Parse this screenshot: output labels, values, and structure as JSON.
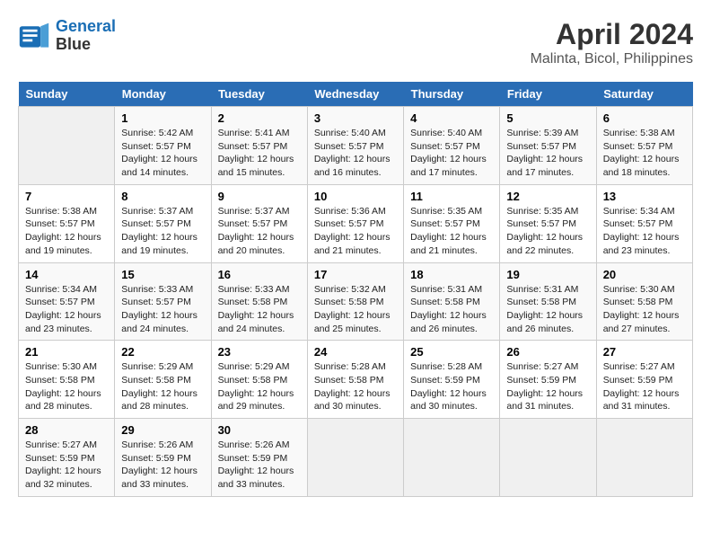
{
  "header": {
    "logo_line1": "General",
    "logo_line2": "Blue",
    "title": "April 2024",
    "subtitle": "Malinta, Bicol, Philippines"
  },
  "weekdays": [
    "Sunday",
    "Monday",
    "Tuesday",
    "Wednesday",
    "Thursday",
    "Friday",
    "Saturday"
  ],
  "weeks": [
    [
      {
        "day": "",
        "empty": true
      },
      {
        "day": "1",
        "sunrise": "5:42 AM",
        "sunset": "5:57 PM",
        "daylight": "12 hours and 14 minutes."
      },
      {
        "day": "2",
        "sunrise": "5:41 AM",
        "sunset": "5:57 PM",
        "daylight": "12 hours and 15 minutes."
      },
      {
        "day": "3",
        "sunrise": "5:40 AM",
        "sunset": "5:57 PM",
        "daylight": "12 hours and 16 minutes."
      },
      {
        "day": "4",
        "sunrise": "5:40 AM",
        "sunset": "5:57 PM",
        "daylight": "12 hours and 17 minutes."
      },
      {
        "day": "5",
        "sunrise": "5:39 AM",
        "sunset": "5:57 PM",
        "daylight": "12 hours and 17 minutes."
      },
      {
        "day": "6",
        "sunrise": "5:38 AM",
        "sunset": "5:57 PM",
        "daylight": "12 hours and 18 minutes."
      }
    ],
    [
      {
        "day": "7",
        "sunrise": "5:38 AM",
        "sunset": "5:57 PM",
        "daylight": "12 hours and 19 minutes."
      },
      {
        "day": "8",
        "sunrise": "5:37 AM",
        "sunset": "5:57 PM",
        "daylight": "12 hours and 19 minutes."
      },
      {
        "day": "9",
        "sunrise": "5:37 AM",
        "sunset": "5:57 PM",
        "daylight": "12 hours and 20 minutes."
      },
      {
        "day": "10",
        "sunrise": "5:36 AM",
        "sunset": "5:57 PM",
        "daylight": "12 hours and 21 minutes."
      },
      {
        "day": "11",
        "sunrise": "5:35 AM",
        "sunset": "5:57 PM",
        "daylight": "12 hours and 21 minutes."
      },
      {
        "day": "12",
        "sunrise": "5:35 AM",
        "sunset": "5:57 PM",
        "daylight": "12 hours and 22 minutes."
      },
      {
        "day": "13",
        "sunrise": "5:34 AM",
        "sunset": "5:57 PM",
        "daylight": "12 hours and 23 minutes."
      }
    ],
    [
      {
        "day": "14",
        "sunrise": "5:34 AM",
        "sunset": "5:57 PM",
        "daylight": "12 hours and 23 minutes."
      },
      {
        "day": "15",
        "sunrise": "5:33 AM",
        "sunset": "5:57 PM",
        "daylight": "12 hours and 24 minutes."
      },
      {
        "day": "16",
        "sunrise": "5:33 AM",
        "sunset": "5:58 PM",
        "daylight": "12 hours and 24 minutes."
      },
      {
        "day": "17",
        "sunrise": "5:32 AM",
        "sunset": "5:58 PM",
        "daylight": "12 hours and 25 minutes."
      },
      {
        "day": "18",
        "sunrise": "5:31 AM",
        "sunset": "5:58 PM",
        "daylight": "12 hours and 26 minutes."
      },
      {
        "day": "19",
        "sunrise": "5:31 AM",
        "sunset": "5:58 PM",
        "daylight": "12 hours and 26 minutes."
      },
      {
        "day": "20",
        "sunrise": "5:30 AM",
        "sunset": "5:58 PM",
        "daylight": "12 hours and 27 minutes."
      }
    ],
    [
      {
        "day": "21",
        "sunrise": "5:30 AM",
        "sunset": "5:58 PM",
        "daylight": "12 hours and 28 minutes."
      },
      {
        "day": "22",
        "sunrise": "5:29 AM",
        "sunset": "5:58 PM",
        "daylight": "12 hours and 28 minutes."
      },
      {
        "day": "23",
        "sunrise": "5:29 AM",
        "sunset": "5:58 PM",
        "daylight": "12 hours and 29 minutes."
      },
      {
        "day": "24",
        "sunrise": "5:28 AM",
        "sunset": "5:58 PM",
        "daylight": "12 hours and 30 minutes."
      },
      {
        "day": "25",
        "sunrise": "5:28 AM",
        "sunset": "5:59 PM",
        "daylight": "12 hours and 30 minutes."
      },
      {
        "day": "26",
        "sunrise": "5:27 AM",
        "sunset": "5:59 PM",
        "daylight": "12 hours and 31 minutes."
      },
      {
        "day": "27",
        "sunrise": "5:27 AM",
        "sunset": "5:59 PM",
        "daylight": "12 hours and 31 minutes."
      }
    ],
    [
      {
        "day": "28",
        "sunrise": "5:27 AM",
        "sunset": "5:59 PM",
        "daylight": "12 hours and 32 minutes."
      },
      {
        "day": "29",
        "sunrise": "5:26 AM",
        "sunset": "5:59 PM",
        "daylight": "12 hours and 33 minutes."
      },
      {
        "day": "30",
        "sunrise": "5:26 AM",
        "sunset": "5:59 PM",
        "daylight": "12 hours and 33 minutes."
      },
      {
        "day": "",
        "empty": true
      },
      {
        "day": "",
        "empty": true
      },
      {
        "day": "",
        "empty": true
      },
      {
        "day": "",
        "empty": true
      }
    ]
  ]
}
